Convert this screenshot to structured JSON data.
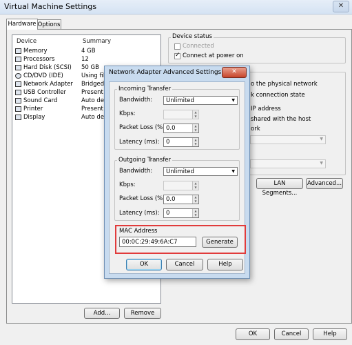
{
  "window": {
    "title": "Virtual Machine Settings",
    "close_glyph": "✕"
  },
  "tabs": [
    {
      "label": "Hardware"
    },
    {
      "label": "Options"
    }
  ],
  "hardware": {
    "col_device": "Device",
    "col_summary": "Summary",
    "items": [
      {
        "name": "Memory",
        "summary": "4 GB",
        "icon": "memory-icon"
      },
      {
        "name": "Processors",
        "summary": "12",
        "icon": "processor-icon"
      },
      {
        "name": "Hard Disk (SCSI)",
        "summary": "50 GB",
        "icon": "hard-disk-icon"
      },
      {
        "name": "CD/DVD (IDE)",
        "summary": "Using fil",
        "icon": "cd-dvd-icon"
      },
      {
        "name": "Network Adapter",
        "summary": "Bridged (",
        "icon": "network-adapter-icon"
      },
      {
        "name": "USB Controller",
        "summary": "Present",
        "icon": "usb-icon"
      },
      {
        "name": "Sound Card",
        "summary": "Auto det",
        "icon": "sound-icon"
      },
      {
        "name": "Printer",
        "summary": "Present",
        "icon": "printer-icon"
      },
      {
        "name": "Display",
        "summary": "Auto det",
        "icon": "display-icon"
      }
    ],
    "add_label": "Add...",
    "remove_label": "Remove"
  },
  "device_status": {
    "label": "Device status",
    "connected": {
      "label": "Connected",
      "checked": false
    },
    "connect_power_on": {
      "label": "Connect at power on",
      "checked": true
    }
  },
  "network_connection": {
    "partial_1": "o the physical network",
    "partial_2": "k connection state",
    "partial_3": "IP address",
    "partial_4": "shared with the host",
    "partial_5": "ork",
    "lan_segments_label": "LAN Segments...",
    "advanced_label": "Advanced..."
  },
  "footer": {
    "ok": "OK",
    "cancel": "Cancel",
    "help": "Help"
  },
  "dialog": {
    "title": "Network Adapter Advanced Settings",
    "close_glyph": "✕",
    "incoming": {
      "label": "Incoming Transfer",
      "bandwidth_label": "Bandwidth:",
      "bandwidth_value": "Unlimited",
      "kbps_label": "Kbps:",
      "kbps_value": "",
      "packet_loss_label": "Packet Loss (%):",
      "packet_loss_value": "0.0",
      "latency_label": "Latency (ms):",
      "latency_value": "0"
    },
    "outgoing": {
      "label": "Outgoing Transfer",
      "bandwidth_label": "Bandwidth:",
      "bandwidth_value": "Unlimited",
      "kbps_label": "Kbps:",
      "kbps_value": "",
      "packet_loss_label": "Packet Loss (%):",
      "packet_loss_value": "0.0",
      "latency_label": "Latency (ms):",
      "latency_value": "0"
    },
    "mac": {
      "label": "MAC Address",
      "value": "00:0C:29:49:6A:C7",
      "generate_label": "Generate"
    },
    "ok": "OK",
    "cancel": "Cancel",
    "help": "Help"
  },
  "colors": {
    "highlight_box": "#e13b3b",
    "dialog_frame": "#c8dbef",
    "close_red": "#c7452b"
  }
}
